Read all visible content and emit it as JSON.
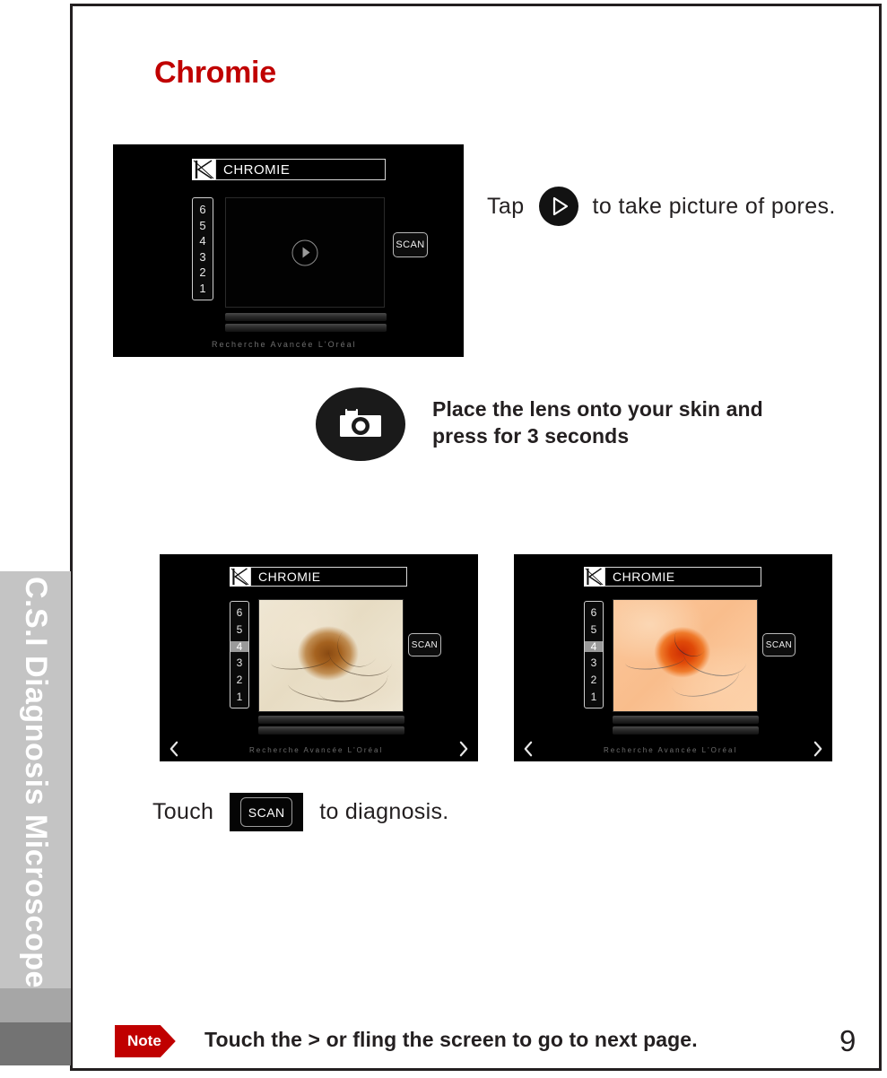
{
  "page": {
    "heading": "Chromie",
    "number": "9",
    "sidebar_label": "C.S.I Diagnosis Microscope"
  },
  "steps": {
    "tap": {
      "before": "Tap",
      "icon": "play-icon",
      "after": "to take picture of pores."
    },
    "camera": {
      "icon": "camera-icon",
      "line1": "Place the lens onto your skin and",
      "line2": "press for 3 seconds"
    },
    "touch": {
      "before": "Touch",
      "chip": "SCAN",
      "after": "to diagnosis."
    }
  },
  "devices": [
    {
      "id": "device-empty",
      "logo": "k-logo-icon",
      "title": "CHROMIE",
      "levels": [
        "6",
        "5",
        "4",
        "3",
        "2",
        "1"
      ],
      "active_level": null,
      "scan_label": "SCAN",
      "footer": "Recherche Avancée L'Oréal",
      "prev_icon": "chevron-left-icon",
      "next_icon": "chevron-right-icon",
      "viewport_state": "play-placeholder"
    },
    {
      "id": "device-skin-normal",
      "logo": "k-logo-icon",
      "title": "CHROMIE",
      "levels": [
        "6",
        "5",
        "4",
        "3",
        "2",
        "1"
      ],
      "active_level": "4",
      "scan_label": "SCAN",
      "footer": "Recherche Avancée L'Oréal",
      "prev_icon": "chevron-left-icon",
      "next_icon": "chevron-right-icon",
      "viewport_state": "skin-normal"
    },
    {
      "id": "device-skin-analyzed",
      "logo": "k-logo-icon",
      "title": "CHROMIE",
      "levels": [
        "6",
        "5",
        "4",
        "3",
        "2",
        "1"
      ],
      "active_level": "4",
      "scan_label": "SCAN",
      "footer": "Recherche Avancée L'Oréal",
      "prev_icon": "chevron-left-icon",
      "next_icon": "chevron-right-icon",
      "viewport_state": "skin-orange"
    }
  ],
  "note": {
    "tag": "Note",
    "text": "Touch the  > or fling the screen to go to next  page."
  },
  "colors": {
    "accent_red": "#c00000",
    "ink": "#231f20",
    "sidebar_gray": "#c4c4c4"
  }
}
